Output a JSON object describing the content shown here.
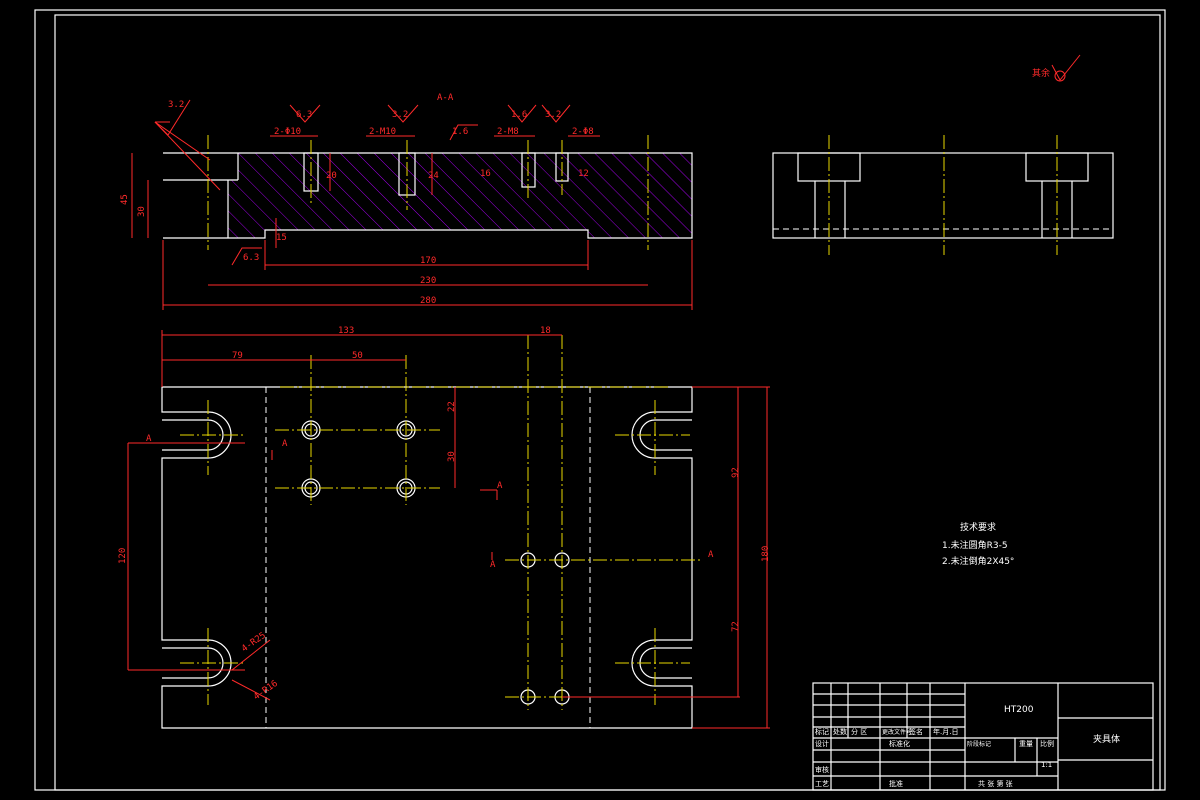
{
  "section_label": "A-A",
  "section_markers": [
    "A",
    "A",
    "A",
    "A",
    "A",
    "A"
  ],
  "dimensions": {
    "hole_d10": "2-Φ10",
    "hole_m10": "2-M10",
    "hole_m8": "2-M8",
    "hole_d8": "2-Φ8",
    "d170": "170",
    "d230": "230",
    "d280": "280",
    "d45": "45",
    "d30_left": "30",
    "d20": "20",
    "d24": "24",
    "d15": "15",
    "d16": "16",
    "d12": "12",
    "d133": "133",
    "d18": "18",
    "d79": "79",
    "d50": "50",
    "d22": "22",
    "d30_plan": "30",
    "d120": "120",
    "d180": "180",
    "d92": "92",
    "d72": "72",
    "r25": "4-R25",
    "r16": "4-R16"
  },
  "roughness": {
    "r1": "3.2",
    "r2": "6.3",
    "r3": "3.2",
    "r4": "1.6",
    "r5": "1.6",
    "r6": "3.2",
    "r7": "6.3",
    "rest": "其余"
  },
  "tech_requirements": {
    "title": "技术要求",
    "line1": "1.未注圆角R3-5",
    "line2": "2.未注倒角2X45°"
  },
  "title_block": {
    "material": "HT200",
    "part_name": "夹具体",
    "row_headers": [
      "标记",
      "处数",
      "分  区",
      "更改文件号",
      "签名",
      "年.月.日"
    ],
    "designer": "设计",
    "standardization": "标准化",
    "checker": "审核",
    "process": "工艺",
    "approve": "批准",
    "stage_mark": "阶段标记",
    "weight": "重量",
    "scale_label": "比例",
    "scale": "1:1",
    "sheets": "共  张  第  张"
  }
}
